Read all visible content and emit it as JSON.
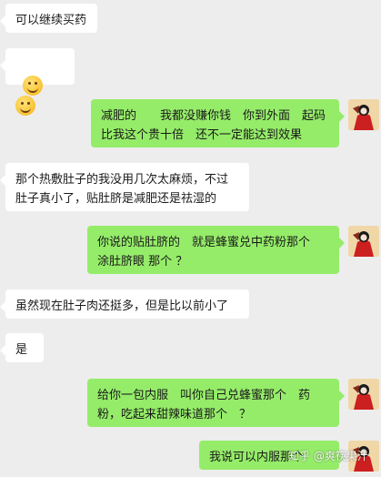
{
  "messages": [
    {
      "side": "left",
      "text": "可以继续买药"
    },
    {
      "side": "left",
      "text": "",
      "emoji": [
        "grinning-face-sweat-emoji",
        "grinning-face-sweat-emoji"
      ]
    },
    {
      "side": "right",
      "text": "减肥的　　我都没赚你钱　你到外面　起码比我这个贵十倍　还不一定能达到效果"
    },
    {
      "side": "left",
      "text": "那个热敷肚子的我没用几次太麻烦，不过肚子真小了，贴肚脐是减肥还是祛湿的"
    },
    {
      "side": "right",
      "text": "你说的贴肚脐的　就是蜂蜜兑中药粉那个　涂肚脐眼 那个 ？"
    },
    {
      "side": "left",
      "text": "虽然现在肚子肉还挺多，但是比以前小了"
    },
    {
      "side": "left",
      "text": "是"
    },
    {
      "side": "right",
      "text": "给你一包内服　叫你自己兑蜂蜜那个　药粉，吃起来甜辣味道那个　？"
    },
    {
      "side": "right",
      "text": "我说可以内服那个"
    }
  ],
  "watermark": "知乎 @爽筷果汁",
  "colors": {
    "background": "#ededed",
    "left_bubble": "#ffffff",
    "right_bubble": "#95ec69"
  }
}
